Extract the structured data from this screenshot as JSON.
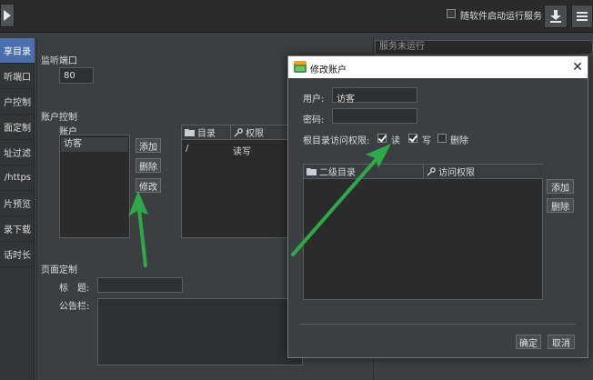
{
  "topbar": {
    "autostart_label": "随软件启动运行服务"
  },
  "sidebar": {
    "items": [
      {
        "label": "享目录",
        "active": true
      },
      {
        "label": "听端口",
        "active": false
      },
      {
        "label": "户控制",
        "active": false
      },
      {
        "label": "面定制",
        "active": false
      },
      {
        "label": "址过滤",
        "active": false
      },
      {
        "label": "/https",
        "active": false
      },
      {
        "label": "片预览",
        "active": false
      },
      {
        "label": "录下载",
        "active": false
      },
      {
        "label": "话时长",
        "active": false
      }
    ]
  },
  "main": {
    "listen_port_label": "监听端口",
    "port_value": "80",
    "account_control_label": "账户控制",
    "account_label": "账户",
    "accounts": [
      "访客"
    ],
    "add_label": "添加",
    "delete_label": "删除",
    "modify_label": "修改",
    "perm_table": {
      "col_dir": "目录",
      "col_perm": "权限",
      "rows": [
        {
          "dir": "/",
          "perm": "读写"
        }
      ]
    },
    "page_custom_label": "页面定制",
    "title_label": "标　题:",
    "notice_label": "公告栏:"
  },
  "right": {
    "status_text": "服务未运行"
  },
  "dialog": {
    "title": "修改账户",
    "user_label": "用户:",
    "user_value": "访客",
    "password_label": "密码:",
    "password_value": "",
    "root_access_label": "根目录访问权限:",
    "read_label": "读",
    "read_checked": true,
    "write_label": "写",
    "write_checked": true,
    "delete_label": "删除",
    "delete_checked": false,
    "table": {
      "col_subdir": "二级目录",
      "col_access": "访问权限"
    },
    "add_label": "添加",
    "remove_label": "删除",
    "ok_label": "确定",
    "cancel_label": "取消"
  },
  "colors": {
    "background": "#3c3f41",
    "sidebar_active": "#4b6eaf",
    "arrow": "#2ea84a"
  }
}
